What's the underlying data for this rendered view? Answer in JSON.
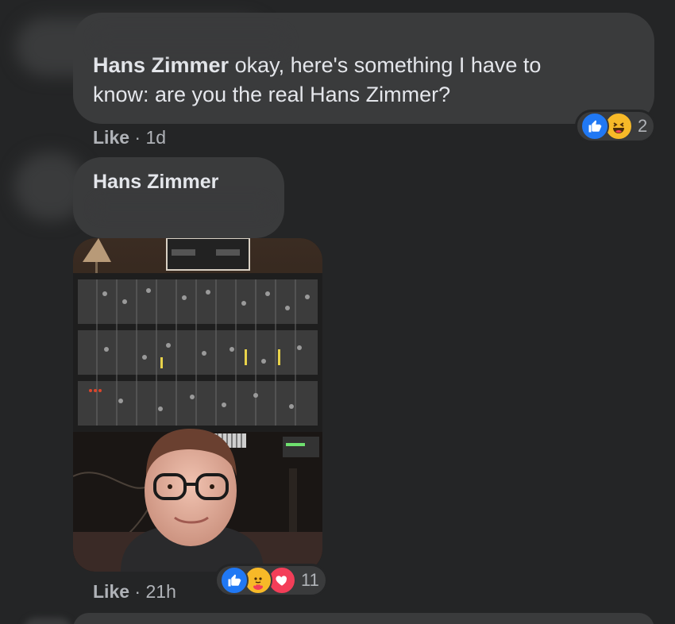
{
  "comment1": {
    "author": "Hans Zimmer",
    "text": "okay, here's something I have to know: are you the real Hans Zimmer?",
    "text_line1": "okay, here's something I have to",
    "text_line2": "know: are you the real Hans Zimmer?",
    "like_label": "Like",
    "separator": "·",
    "time": "1d",
    "reactions": [
      "like-icon",
      "haha-icon"
    ],
    "reaction_count": "2"
  },
  "comment2": {
    "author": "Hans Zimmer",
    "like_label": "Like",
    "separator": "·",
    "time": "21h",
    "reactions": [
      "like-icon",
      "care-icon",
      "love-icon"
    ],
    "reaction_count": "11"
  },
  "colors": {
    "background": "#242526",
    "bubble": "#3a3b3c",
    "like_blue": "#2078f4",
    "haha_yellow": "#f7b928",
    "love_red": "#f33e58"
  }
}
